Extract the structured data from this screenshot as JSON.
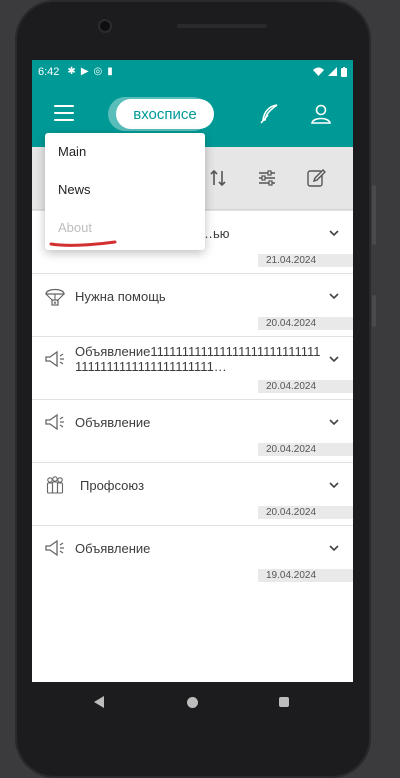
{
  "status": {
    "time": "6:42"
  },
  "app": {
    "logo_text": "вхосписе"
  },
  "menu": {
    "items": [
      {
        "label": "Main"
      },
      {
        "label": "News"
      },
      {
        "label": "About"
      }
    ]
  },
  "posts": [
    {
      "title": "…ью",
      "date": "21.04.2024",
      "icon": "none"
    },
    {
      "title": "Нужна помощь",
      "date": "20.04.2024",
      "icon": "parachute-icon"
    },
    {
      "title": "Объявление1111111111111111111111111111111111111111111111111…",
      "date": "20.04.2024",
      "icon": "megaphone-icon"
    },
    {
      "title": "Объявление",
      "date": "20.04.2024",
      "icon": "megaphone-icon"
    },
    {
      "title": "Профсоюз",
      "date": "20.04.2024",
      "icon": "group-icon"
    },
    {
      "title": "Объявление",
      "date": "19.04.2024",
      "icon": "megaphone-icon"
    }
  ],
  "colors": {
    "brand": "#009a96",
    "annotation": "#d32f2f"
  }
}
